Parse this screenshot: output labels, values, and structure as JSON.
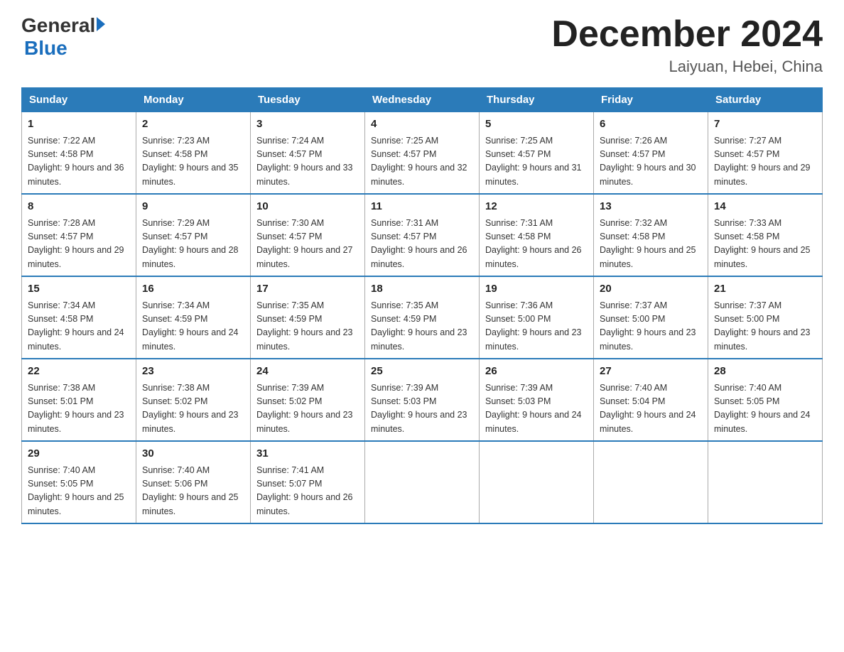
{
  "header": {
    "logo_general": "General",
    "logo_blue": "Blue",
    "month_title": "December 2024",
    "location": "Laiyuan, Hebei, China"
  },
  "weekdays": [
    "Sunday",
    "Monday",
    "Tuesday",
    "Wednesday",
    "Thursday",
    "Friday",
    "Saturday"
  ],
  "weeks": [
    [
      {
        "day": "1",
        "sunrise": "7:22 AM",
        "sunset": "4:58 PM",
        "daylight": "9 hours and 36 minutes."
      },
      {
        "day": "2",
        "sunrise": "7:23 AM",
        "sunset": "4:58 PM",
        "daylight": "9 hours and 35 minutes."
      },
      {
        "day": "3",
        "sunrise": "7:24 AM",
        "sunset": "4:57 PM",
        "daylight": "9 hours and 33 minutes."
      },
      {
        "day": "4",
        "sunrise": "7:25 AM",
        "sunset": "4:57 PM",
        "daylight": "9 hours and 32 minutes."
      },
      {
        "day": "5",
        "sunrise": "7:25 AM",
        "sunset": "4:57 PM",
        "daylight": "9 hours and 31 minutes."
      },
      {
        "day": "6",
        "sunrise": "7:26 AM",
        "sunset": "4:57 PM",
        "daylight": "9 hours and 30 minutes."
      },
      {
        "day": "7",
        "sunrise": "7:27 AM",
        "sunset": "4:57 PM",
        "daylight": "9 hours and 29 minutes."
      }
    ],
    [
      {
        "day": "8",
        "sunrise": "7:28 AM",
        "sunset": "4:57 PM",
        "daylight": "9 hours and 29 minutes."
      },
      {
        "day": "9",
        "sunrise": "7:29 AM",
        "sunset": "4:57 PM",
        "daylight": "9 hours and 28 minutes."
      },
      {
        "day": "10",
        "sunrise": "7:30 AM",
        "sunset": "4:57 PM",
        "daylight": "9 hours and 27 minutes."
      },
      {
        "day": "11",
        "sunrise": "7:31 AM",
        "sunset": "4:57 PM",
        "daylight": "9 hours and 26 minutes."
      },
      {
        "day": "12",
        "sunrise": "7:31 AM",
        "sunset": "4:58 PM",
        "daylight": "9 hours and 26 minutes."
      },
      {
        "day": "13",
        "sunrise": "7:32 AM",
        "sunset": "4:58 PM",
        "daylight": "9 hours and 25 minutes."
      },
      {
        "day": "14",
        "sunrise": "7:33 AM",
        "sunset": "4:58 PM",
        "daylight": "9 hours and 25 minutes."
      }
    ],
    [
      {
        "day": "15",
        "sunrise": "7:34 AM",
        "sunset": "4:58 PM",
        "daylight": "9 hours and 24 minutes."
      },
      {
        "day": "16",
        "sunrise": "7:34 AM",
        "sunset": "4:59 PM",
        "daylight": "9 hours and 24 minutes."
      },
      {
        "day": "17",
        "sunrise": "7:35 AM",
        "sunset": "4:59 PM",
        "daylight": "9 hours and 23 minutes."
      },
      {
        "day": "18",
        "sunrise": "7:35 AM",
        "sunset": "4:59 PM",
        "daylight": "9 hours and 23 minutes."
      },
      {
        "day": "19",
        "sunrise": "7:36 AM",
        "sunset": "5:00 PM",
        "daylight": "9 hours and 23 minutes."
      },
      {
        "day": "20",
        "sunrise": "7:37 AM",
        "sunset": "5:00 PM",
        "daylight": "9 hours and 23 minutes."
      },
      {
        "day": "21",
        "sunrise": "7:37 AM",
        "sunset": "5:00 PM",
        "daylight": "9 hours and 23 minutes."
      }
    ],
    [
      {
        "day": "22",
        "sunrise": "7:38 AM",
        "sunset": "5:01 PM",
        "daylight": "9 hours and 23 minutes."
      },
      {
        "day": "23",
        "sunrise": "7:38 AM",
        "sunset": "5:02 PM",
        "daylight": "9 hours and 23 minutes."
      },
      {
        "day": "24",
        "sunrise": "7:39 AM",
        "sunset": "5:02 PM",
        "daylight": "9 hours and 23 minutes."
      },
      {
        "day": "25",
        "sunrise": "7:39 AM",
        "sunset": "5:03 PM",
        "daylight": "9 hours and 23 minutes."
      },
      {
        "day": "26",
        "sunrise": "7:39 AM",
        "sunset": "5:03 PM",
        "daylight": "9 hours and 24 minutes."
      },
      {
        "day": "27",
        "sunrise": "7:40 AM",
        "sunset": "5:04 PM",
        "daylight": "9 hours and 24 minutes."
      },
      {
        "day": "28",
        "sunrise": "7:40 AM",
        "sunset": "5:05 PM",
        "daylight": "9 hours and 24 minutes."
      }
    ],
    [
      {
        "day": "29",
        "sunrise": "7:40 AM",
        "sunset": "5:05 PM",
        "daylight": "9 hours and 25 minutes."
      },
      {
        "day": "30",
        "sunrise": "7:40 AM",
        "sunset": "5:06 PM",
        "daylight": "9 hours and 25 minutes."
      },
      {
        "day": "31",
        "sunrise": "7:41 AM",
        "sunset": "5:07 PM",
        "daylight": "9 hours and 26 minutes."
      },
      null,
      null,
      null,
      null
    ]
  ]
}
